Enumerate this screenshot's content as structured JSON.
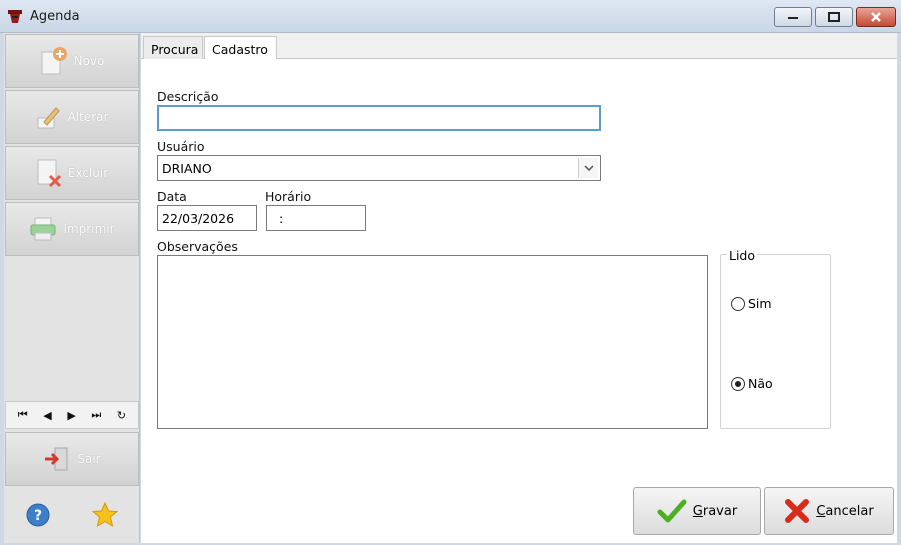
{
  "window": {
    "title": "Agenda",
    "min_icon": "minimize-icon",
    "max_icon": "restore-icon",
    "close_icon": "close-icon"
  },
  "sidebar": {
    "novo": "Novo",
    "alterar": "Alterar",
    "excluir": "Excluir",
    "imprimir": "Imprimir",
    "sair": "Sair",
    "nav": [
      "⏮",
      "◀",
      "▶",
      "⏭",
      "↻"
    ]
  },
  "tabs": {
    "procura": "Procura",
    "cadastro": "Cadastro"
  },
  "form": {
    "descricao_label": "Descrição",
    "descricao_value": "",
    "usuario_label": "Usuário",
    "usuario_value": "DRIANO",
    "data_label": "Data",
    "data_value": "22/03/2026",
    "horario_label": "Horário",
    "horario_value": ":",
    "observacoes_label": "Observações",
    "lido_label": "Lido",
    "sim_label": "Sim",
    "nao_label": "Não"
  },
  "buttons": {
    "gravar_prefix": "G",
    "gravar_rest": "ravar",
    "cancelar_prefix": "C",
    "cancelar_rest": "ancelar"
  },
  "colors": {
    "accent_focus": "#5b9bd5",
    "gravar_check": "#4caf23",
    "cancelar_x": "#d72c1b"
  }
}
